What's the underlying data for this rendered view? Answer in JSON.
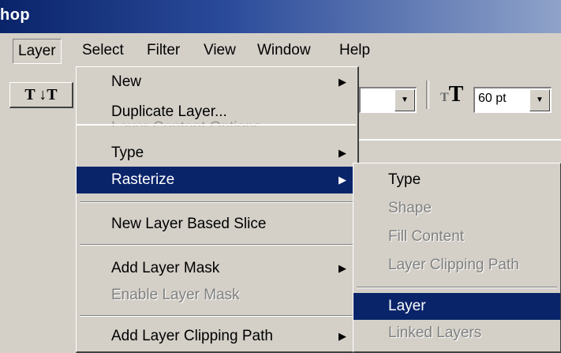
{
  "title": "hop",
  "menubar": [
    {
      "label": "Layer",
      "active": true
    },
    {
      "label": "Select"
    },
    {
      "label": "Filter"
    },
    {
      "label": "View"
    },
    {
      "label": "Window"
    },
    {
      "label": "Help"
    }
  ],
  "toolbar": {
    "orientation_label": "T ↓T",
    "font_size": "60 pt",
    "font_size_icon": "tT"
  },
  "layer_menu": {
    "items": [
      {
        "label": "New",
        "submenu": true
      },
      {
        "label": "Duplicate Layer..."
      },
      {
        "label": "Layer Content Options...",
        "partial": true
      },
      {
        "label": "Type",
        "submenu": true
      },
      {
        "label": "Rasterize",
        "submenu": true,
        "highlighted": true
      },
      {
        "label": "New Layer Based Slice"
      },
      {
        "label": "Add Layer Mask",
        "submenu": true
      },
      {
        "label": "Enable Layer Mask",
        "disabled": true
      },
      {
        "label": "Add Layer Clipping Path",
        "submenu": true
      }
    ]
  },
  "rasterize_submenu": {
    "items": [
      {
        "label": "Type"
      },
      {
        "label": "Shape",
        "disabled": true
      },
      {
        "label": "Fill Content",
        "disabled": true
      },
      {
        "label": "Layer Clipping Path",
        "disabled": true
      },
      {
        "label": "Layer",
        "highlighted": true
      },
      {
        "label": "Linked Layers",
        "disabled": true
      }
    ]
  },
  "colors": {
    "menu_bg": "#d4d0c8",
    "highlight": "#0a246a",
    "disabled": "#808080"
  }
}
